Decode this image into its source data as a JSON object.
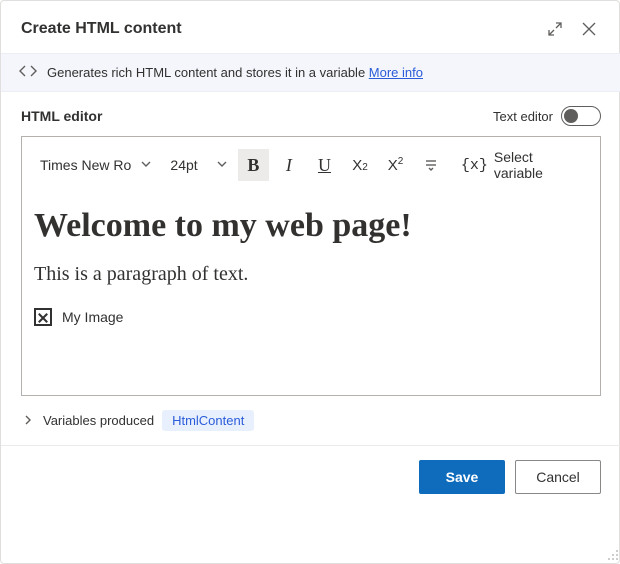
{
  "header": {
    "title": "Create HTML content"
  },
  "info": {
    "text": "Generates rich HTML content and stores it in a variable",
    "moreInfo": "More info"
  },
  "editor": {
    "label": "HTML editor",
    "textEditorLabel": "Text editor",
    "textEditorEnabled": false,
    "toolbar": {
      "fontFamily": "Times New Rom",
      "fontSize": "24pt",
      "selectVariable": "Select variable"
    },
    "content": {
      "heading": "Welcome to my web page!",
      "paragraph": "This is a paragraph of text.",
      "imageAlt": "My Image"
    }
  },
  "variablesProduced": {
    "label": "Variables produced",
    "chip": "HtmlContent"
  },
  "footer": {
    "save": "Save",
    "cancel": "Cancel"
  }
}
